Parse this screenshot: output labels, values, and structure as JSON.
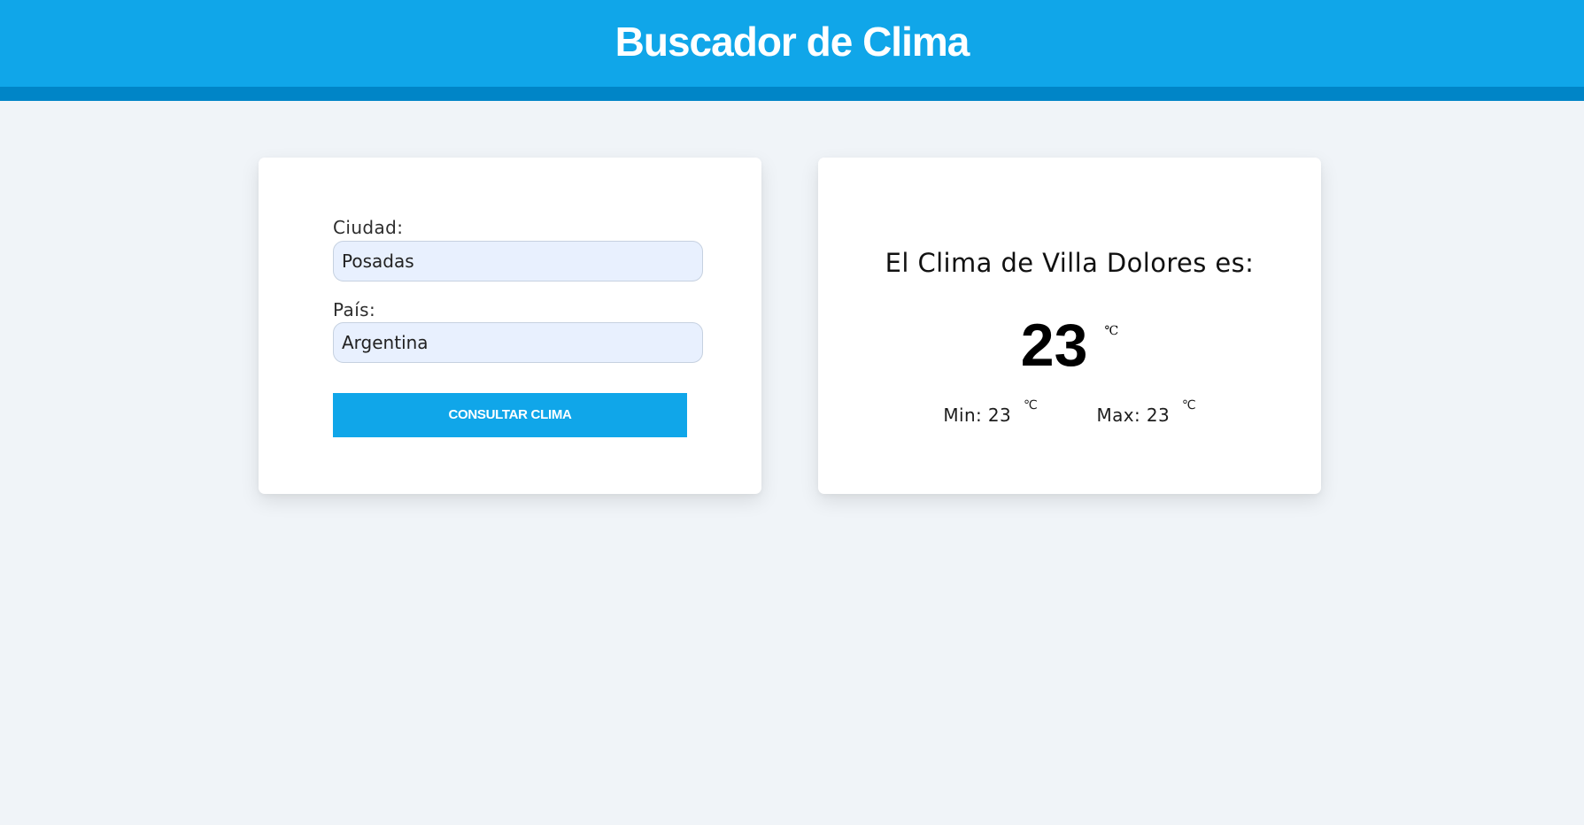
{
  "header": {
    "title": "Buscador de Clima"
  },
  "search_form": {
    "city_label": "Ciudad:",
    "city_value": "Posadas",
    "country_label": "País:",
    "country_value": "Argentina",
    "submit_label": "CONSULTAR CLIMA"
  },
  "weather_result": {
    "heading": "El Clima de Villa Dolores es:",
    "current_temperature": "23",
    "current_unit": "℃",
    "min_label": "Min: 23",
    "min_unit": "℃",
    "max_label": "Max: 23",
    "max_unit": "℃"
  },
  "colors": {
    "primary": "#10a6e9",
    "primary_dark": "#0085c7",
    "page_background": "#f0f4f8",
    "input_background": "#e8f0fe",
    "card_background": "#ffffff"
  }
}
